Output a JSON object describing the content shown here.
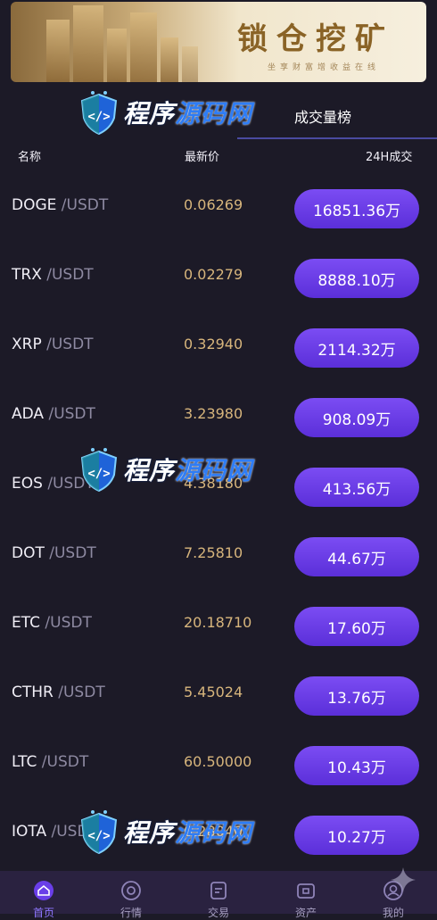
{
  "banner": {
    "title": "锁仓挖矿",
    "subtitle": "坐享财富增收益在线"
  },
  "tabs": {
    "active_label": "成交量榜"
  },
  "columns": {
    "name": "名称",
    "price": "最新价",
    "volume": "24H成交"
  },
  "rows": [
    {
      "base": "DOGE",
      "quote": " /USDT",
      "price": "0.06269",
      "volume": "16851.36万"
    },
    {
      "base": "TRX",
      "quote": " /USDT",
      "price": "0.02279",
      "volume": "8888.10万"
    },
    {
      "base": "XRP",
      "quote": " /USDT",
      "price": "0.32940",
      "volume": "2114.32万"
    },
    {
      "base": "ADA",
      "quote": " /USDT",
      "price": "3.23980",
      "volume": "908.09万"
    },
    {
      "base": "EOS",
      "quote": " /USDT",
      "price": "4.38180",
      "volume": "413.56万"
    },
    {
      "base": "DOT",
      "quote": " /USDT",
      "price": "7.25810",
      "volume": "44.67万"
    },
    {
      "base": "ETC",
      "quote": " /USDT",
      "price": "20.18710",
      "volume": "17.60万"
    },
    {
      "base": "CTHR",
      "quote": " /USDT",
      "price": "5.45024",
      "volume": "13.76万"
    },
    {
      "base": "LTC",
      "quote": " /USDT",
      "price": "60.50000",
      "volume": "10.43万"
    },
    {
      "base": "IOTA",
      "quote": " /USDT",
      "price": "0.28040",
      "volume": "10.27万"
    }
  ],
  "watermark": {
    "part1": "程序",
    "part2": "源码网"
  },
  "nav": [
    {
      "label": "首页",
      "icon": "home-icon"
    },
    {
      "label": "行情",
      "icon": "market-icon"
    },
    {
      "label": "交易",
      "icon": "trade-icon"
    },
    {
      "label": "资产",
      "icon": "wallet-icon"
    },
    {
      "label": "我的",
      "icon": "user-icon"
    }
  ],
  "colors": {
    "accent": "#6a3ee8",
    "price": "#d7b57c",
    "background": "#1c1a27",
    "nav_active": "#8f77ff"
  }
}
